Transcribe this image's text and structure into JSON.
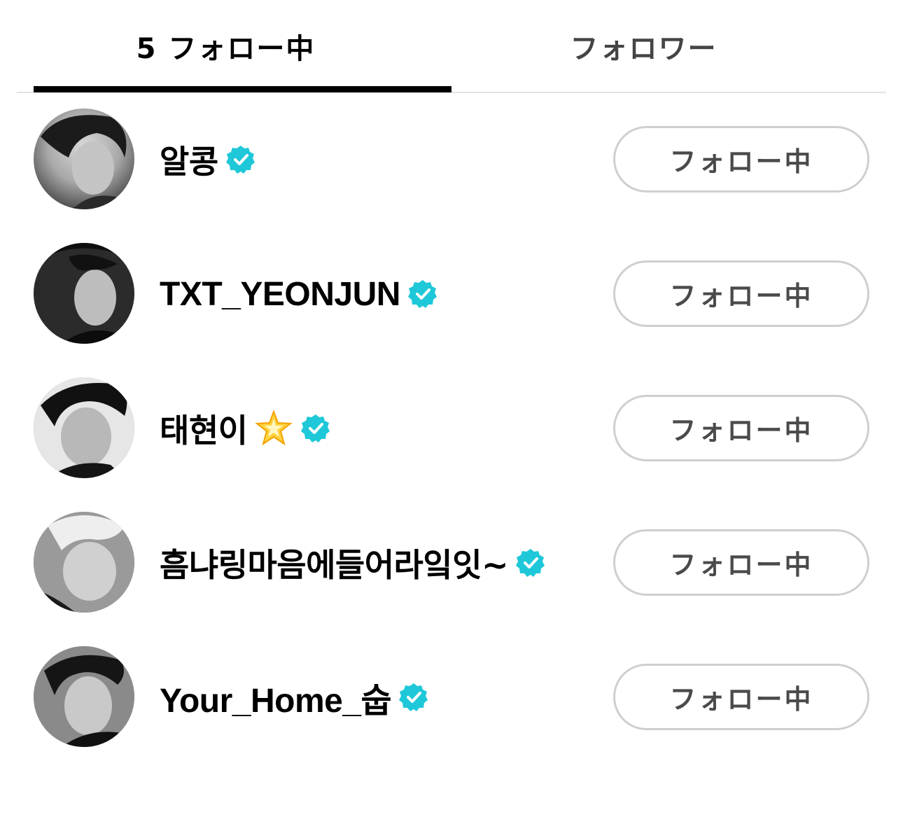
{
  "tabs": {
    "following_label": "5 フォロー中",
    "followers_label": "フォロワー",
    "active": "following"
  },
  "colors": {
    "verified_badge": "#1ec8d8",
    "active_underline": "#000000",
    "button_border": "#cfcfcf"
  },
  "icons": {
    "verified": "verified-badge-icon",
    "emoji": "glowing-star-icon"
  },
  "users": [
    {
      "name": "알콩",
      "verified": true,
      "emoji": null,
      "button_label": "フォロー中"
    },
    {
      "name": "TXT_YEONJUN",
      "verified": true,
      "emoji": null,
      "button_label": "フォロー中"
    },
    {
      "name": "태현이",
      "verified": true,
      "emoji": "🌟",
      "button_label": "フォロー中"
    },
    {
      "name": "흠냐링마음에들어라잌잇~",
      "verified": true,
      "emoji": null,
      "button_label": "フォロー中"
    },
    {
      "name": "Your_Home_숩",
      "verified": true,
      "emoji": null,
      "button_label": "フォロー中"
    }
  ]
}
